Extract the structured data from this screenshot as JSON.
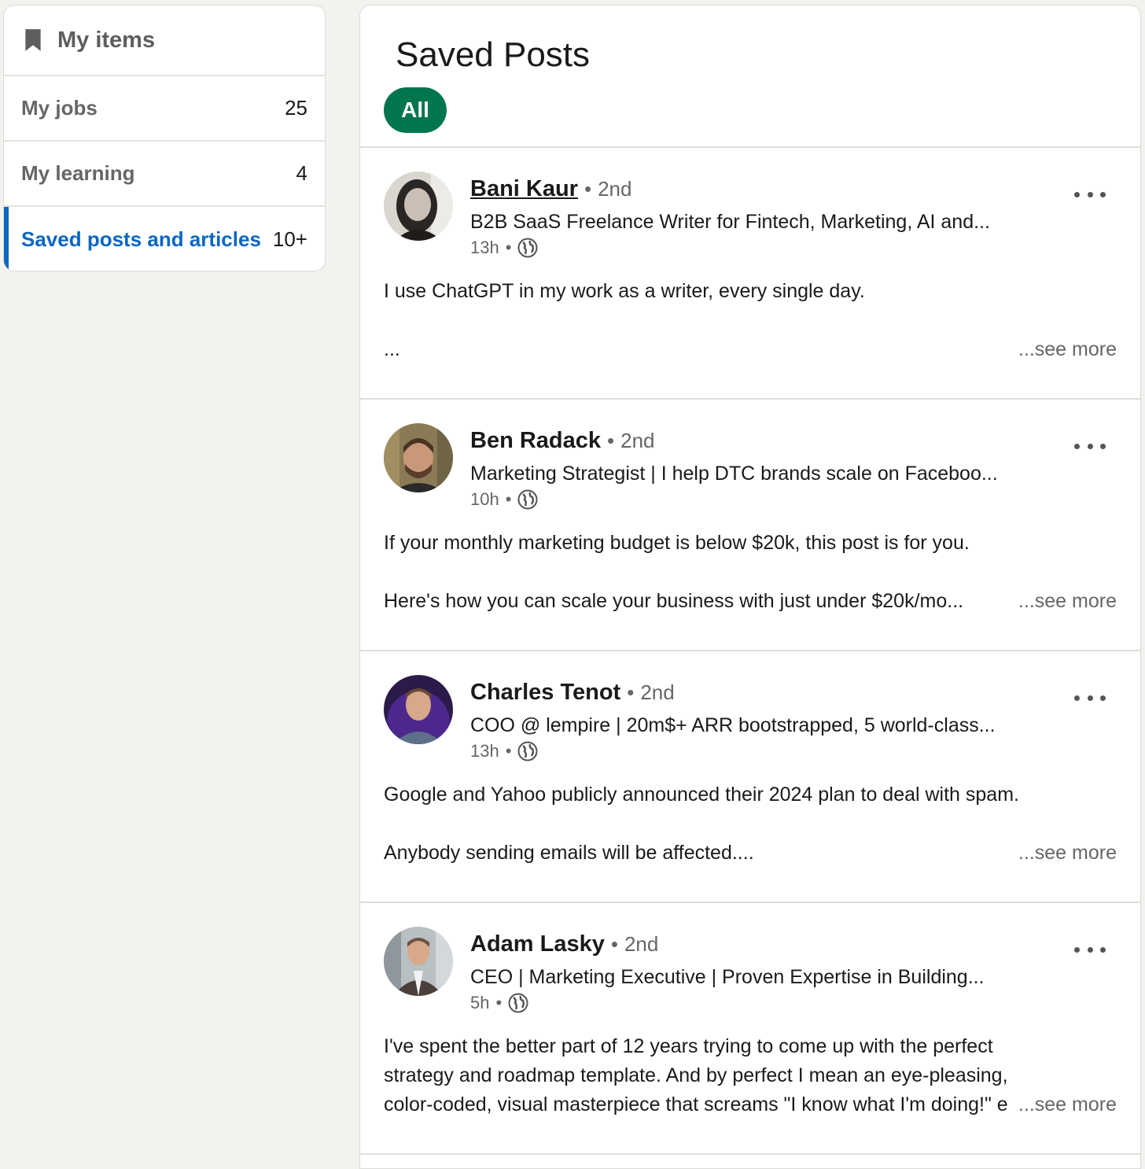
{
  "sidebar": {
    "title": "My items",
    "items": [
      {
        "label": "My jobs",
        "count": "25"
      },
      {
        "label": "My learning",
        "count": "4"
      },
      {
        "label": "Saved posts and articles",
        "count": "10+"
      }
    ]
  },
  "main": {
    "title": "Saved Posts",
    "filter_all": "All",
    "see_more": "...see more",
    "posts": [
      {
        "name": "Bani Kaur",
        "degree": "2nd",
        "headline": "B2B SaaS Freelance Writer for Fintech, Marketing, AI and...",
        "time": "13h",
        "line1": "I use ChatGPT in my work as a writer, every single day.",
        "line2": "..."
      },
      {
        "name": "Ben Radack",
        "degree": "2nd",
        "headline": "Marketing Strategist | I help DTC brands scale on Faceboo...",
        "time": "10h",
        "line1": "If your monthly marketing budget is below $20k, this post is for you.",
        "line2": "Here's how you can scale your business with just under $20k/mo..."
      },
      {
        "name": "Charles Tenot",
        "degree": "2nd",
        "headline": "COO @ lempire | 20m$+ ARR bootstrapped, 5 world-class...",
        "time": "13h",
        "line1": "Google and Yahoo publicly announced their 2024 plan to deal with spam.",
        "line2": "Anybody sending emails will be affected...."
      },
      {
        "name": "Adam Lasky",
        "degree": "2nd",
        "headline": "CEO | Marketing Executive | Proven Expertise in Building...",
        "time": "5h",
        "body": "I've spent the better part of 12 years trying to come up with the perfect strategy and roadmap template. And by perfect I mean an eye-pleasing, color-coded, visual masterpiece that screams \"I know what I'm doing!\" e"
      }
    ]
  },
  "colors": {
    "accent_blue": "#0a66c2",
    "pill_green": "#01754f",
    "background": "#f4f2ee"
  },
  "icons": {
    "bookmark": "bookmark-icon",
    "globe": "globe-icon",
    "menu": "more-options-icon"
  }
}
